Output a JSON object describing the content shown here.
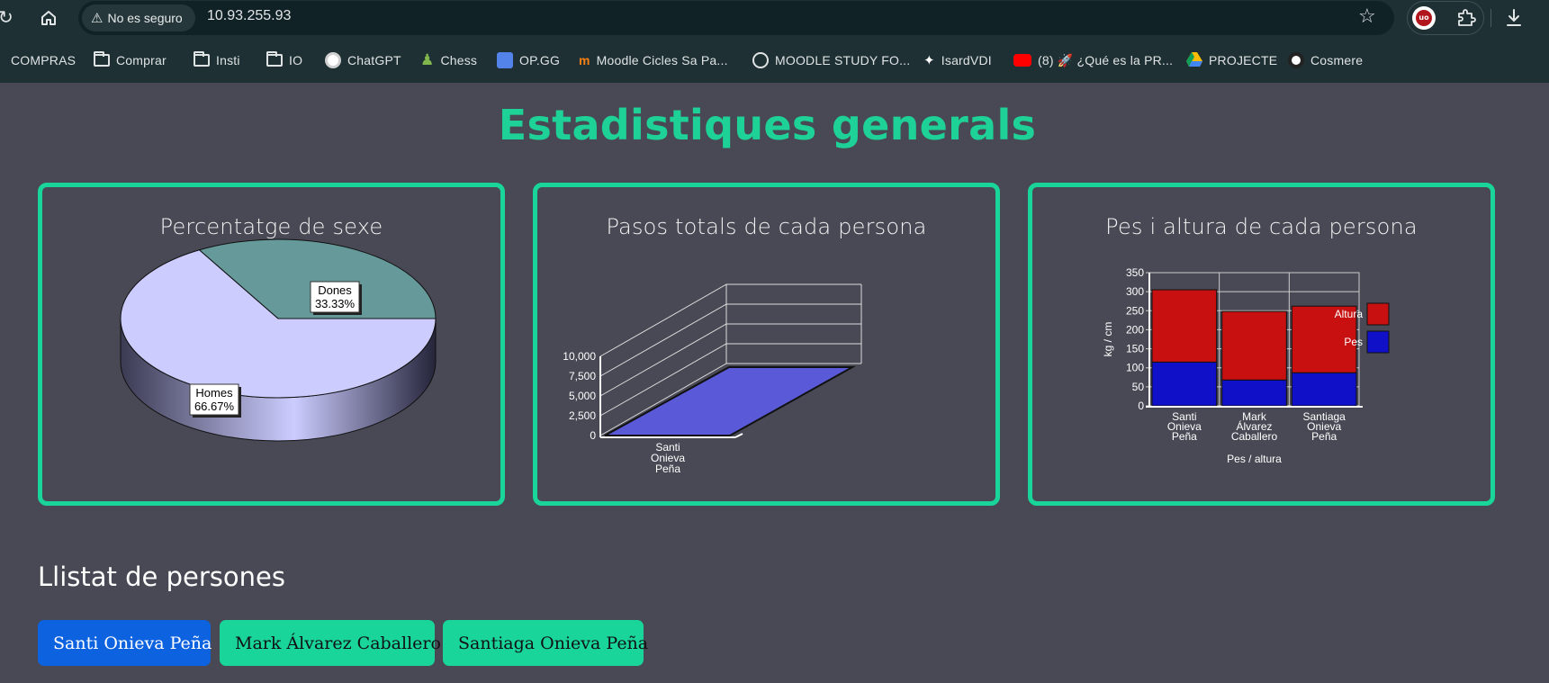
{
  "browser": {
    "security_label": "No es seguro",
    "url": "10.93.255.93",
    "bookmarks": [
      {
        "label": "COMPRAS",
        "icon": "folder-icon"
      },
      {
        "label": "Comprar",
        "icon": "folder-icon"
      },
      {
        "label": "Insti",
        "icon": "folder-icon"
      },
      {
        "label": "IO",
        "icon": "folder-icon"
      },
      {
        "label": "ChatGPT",
        "icon": "chatgpt-icon"
      },
      {
        "label": "Chess",
        "icon": "chess-pawn-icon"
      },
      {
        "label": "OP.GG",
        "icon": "opgg-icon"
      },
      {
        "label": "Moodle Cicles Sa Pa...",
        "icon": "moodle-icon"
      },
      {
        "label": "MOODLE STUDY FO...",
        "icon": "globe-icon"
      },
      {
        "label": "IsardVDI",
        "icon": "isard-icon"
      },
      {
        "label": "(8) 🚀 ¿Qué es la PR...",
        "icon": "youtube-icon"
      },
      {
        "label": "PROJECTE",
        "icon": "drive-icon"
      },
      {
        "label": "Cosmere",
        "icon": "cosmere-icon"
      }
    ]
  },
  "page": {
    "title": "Estadistiques generals",
    "people_heading": "Llistat de persones",
    "people": [
      {
        "name": "Santi Onieva Peña",
        "selected": true
      },
      {
        "name": "Mark Álvarez Caballero",
        "selected": false
      },
      {
        "name": "Santiaga Onieva Peña",
        "selected": false
      }
    ]
  },
  "colors": {
    "accent": "#19d59a",
    "background": "#484954",
    "selected_button": "#0d62e0",
    "button": "#19d59a"
  },
  "chart_data": [
    {
      "type": "pie",
      "title": "Percentatge de sexe",
      "style": "3d",
      "labels": [
        "Homes",
        "Dones"
      ],
      "values": [
        66.67,
        33.33
      ],
      "value_labels": [
        "66.67%",
        "33.33%"
      ],
      "colors": [
        "#ccccff",
        "#669999"
      ]
    },
    {
      "type": "bar",
      "title": "Pasos totals de cada persona",
      "style": "3d",
      "categories": [
        "Santi Onieva Peña"
      ],
      "category_lines": [
        [
          "Santi",
          "Onieva",
          "Peña"
        ]
      ],
      "values": [
        0
      ],
      "ylim": [
        0,
        10000
      ],
      "yticks": [
        "0",
        "2,500",
        "5,000",
        "7,500",
        "10,000"
      ],
      "color": "#5a5ad8"
    },
    {
      "type": "bar",
      "stacked": true,
      "title": "Pes i altura de cada persona",
      "xlabel": "Pes / altura",
      "ylabel": "kg / cm",
      "categories": [
        "Santi Onieva Peña",
        "Mark Álvarez Caballero",
        "Santiaga Onieva Peña"
      ],
      "category_lines": [
        [
          "Santi",
          "Onieva",
          "Peña"
        ],
        [
          "Mark",
          "Álvarez",
          "Caballero"
        ],
        [
          "Santiaga",
          "Onieva",
          "Peña"
        ]
      ],
      "ylim": [
        0,
        350
      ],
      "yticks": [
        "0",
        "50",
        "100",
        "150",
        "200",
        "250",
        "300",
        "350"
      ],
      "legend_position": "right",
      "series": [
        {
          "name": "Pes",
          "values": [
            115,
            68,
            87
          ],
          "color": "#1010c8"
        },
        {
          "name": "Altura",
          "values": [
            190,
            180,
            175
          ],
          "color": "#c81010"
        }
      ],
      "legend": [
        {
          "name": "Altura",
          "color": "#c81010"
        },
        {
          "name": "Pes",
          "color": "#1010c8"
        }
      ]
    }
  ]
}
